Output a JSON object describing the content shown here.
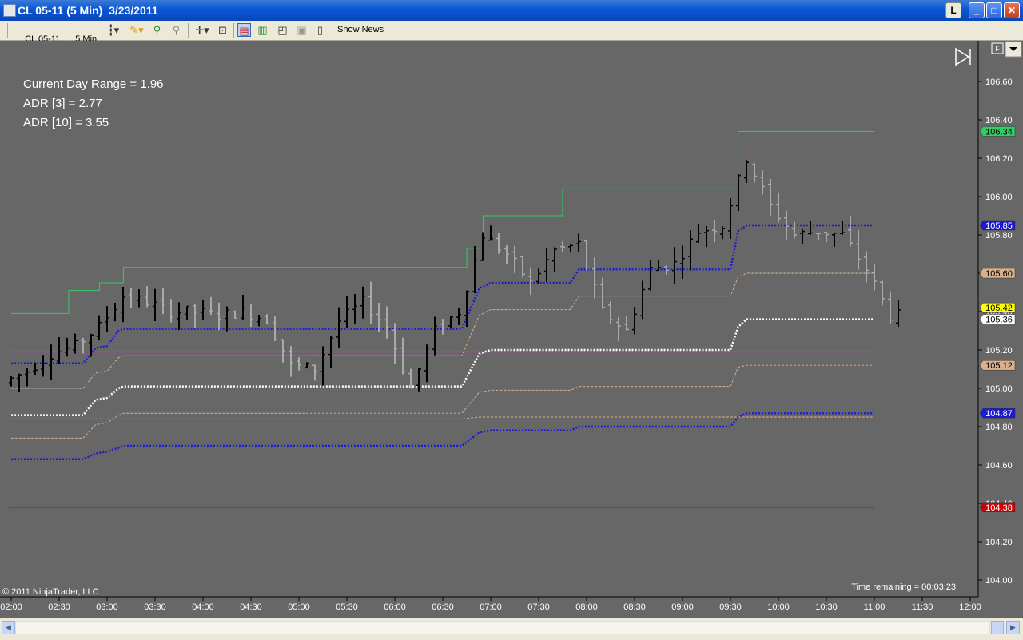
{
  "window": {
    "title": "CL 05-11 (5 Min)  3/23/2011",
    "l_button": "L",
    "minimize": "_",
    "maximize": "□",
    "close": "✕"
  },
  "toolbar": {
    "instrument": "CL 05-11",
    "interval": "5 Min",
    "show_news": "Show News"
  },
  "chart": {
    "stats": [
      "Current Day Range = 1.96",
      "ADR [3] = 2.77",
      "ADR [10] = 3.55"
    ],
    "copyright": "© 2011 NinjaTrader, LLC",
    "time_remaining": "Time remaining = 00:03:23",
    "f_button": "F",
    "colors": {
      "background": "#676767",
      "bar_up": "#000000",
      "bar_down": "#a9a9a9",
      "high_line": "#33cc66",
      "low_line": "#cc0000",
      "magenta_line": "#cc33cc",
      "blue_band": "#1a1ad6",
      "mid_band": "#ffffff",
      "orange_band": "#d8a070"
    }
  },
  "chart_data": {
    "type": "line",
    "title": "CL 05-11 (5 Min) 3/23/2011",
    "xlabel": "",
    "ylabel": "",
    "ylim": [
      103.95,
      106.7
    ],
    "x_ticks": [
      "02:00",
      "02:30",
      "03:00",
      "03:30",
      "04:00",
      "04:30",
      "05:00",
      "05:30",
      "06:00",
      "06:30",
      "07:00",
      "07:30",
      "08:00",
      "08:30",
      "09:00",
      "09:30",
      "10:00",
      "10:30",
      "11:00",
      "11:30",
      "12:00"
    ],
    "y_ticks": [
      "106.60",
      "106.40",
      "106.20",
      "106.00",
      "105.80",
      "105.60",
      "105.40",
      "105.20",
      "105.00",
      "104.80",
      "104.60",
      "104.40",
      "104.20",
      "104.00"
    ],
    "price_markers": [
      {
        "label": "106.34",
        "value": 106.34,
        "color": "#33cc66",
        "text_color": "#000000"
      },
      {
        "label": "105.85",
        "value": 105.85,
        "color": "#1a1ad6",
        "text_color": "#ffffff"
      },
      {
        "label": "105.60",
        "value": 105.6,
        "color": "#d8b08c",
        "text_color": "#000000"
      },
      {
        "label": "105.42",
        "value": 105.42,
        "color": "#ffff00",
        "text_color": "#000000"
      },
      {
        "label": "105.36",
        "value": 105.36,
        "color": "#ffffff",
        "text_color": "#000000"
      },
      {
        "label": "105.12",
        "value": 105.12,
        "color": "#d8b08c",
        "text_color": "#000000"
      },
      {
        "label": "104.87",
        "value": 104.87,
        "color": "#1a1ad6",
        "text_color": "#ffffff"
      },
      {
        "label": "104.38",
        "value": 104.38,
        "color": "#cc0000",
        "text_color": "#ffffff"
      }
    ],
    "horizontal_lines": [
      {
        "name": "day-low",
        "value": 104.38,
        "color": "#cc0000",
        "style": "solid"
      },
      {
        "name": "magenta",
        "value": 105.19,
        "color": "#cc33cc",
        "style": "solid"
      }
    ],
    "step_series": [
      {
        "id": "high",
        "color": "#33cc66",
        "style": "solid",
        "points": [
          [
            2.0,
            105.39
          ],
          [
            2.6,
            105.39
          ],
          [
            2.6,
            105.51
          ],
          [
            2.92,
            105.51
          ],
          [
            2.92,
            105.55
          ],
          [
            3.17,
            105.55
          ],
          [
            3.17,
            105.63
          ],
          [
            6.75,
            105.63
          ],
          [
            6.75,
            105.73
          ],
          [
            6.92,
            105.73
          ],
          [
            6.92,
            105.9
          ],
          [
            7.75,
            105.9
          ],
          [
            7.75,
            106.04
          ],
          [
            9.58,
            106.04
          ],
          [
            9.58,
            106.34
          ],
          [
            11.0,
            106.34
          ]
        ]
      },
      {
        "id": "blue-upper",
        "color": "#1a1ad6",
        "style": "dotted",
        "points": [
          [
            2.0,
            105.13
          ],
          [
            2.75,
            105.13
          ],
          [
            2.88,
            105.21
          ],
          [
            3.0,
            105.22
          ],
          [
            3.12,
            105.3
          ],
          [
            3.17,
            105.31
          ],
          [
            6.7,
            105.31
          ],
          [
            6.88,
            105.52
          ],
          [
            7.0,
            105.55
          ],
          [
            7.83,
            105.55
          ],
          [
            7.92,
            105.62
          ],
          [
            9.5,
            105.62
          ],
          [
            9.58,
            105.82
          ],
          [
            9.67,
            105.85
          ],
          [
            11.0,
            105.85
          ]
        ]
      },
      {
        "id": "orange-upper",
        "color": "#d8b08c",
        "style": "dashed",
        "points": [
          [
            2.0,
            105.0
          ],
          [
            2.75,
            105.0
          ],
          [
            2.88,
            105.08
          ],
          [
            3.0,
            105.09
          ],
          [
            3.12,
            105.16
          ],
          [
            3.17,
            105.17
          ],
          [
            6.7,
            105.17
          ],
          [
            6.88,
            105.38
          ],
          [
            7.0,
            105.41
          ],
          [
            7.83,
            105.41
          ],
          [
            7.92,
            105.48
          ],
          [
            9.5,
            105.48
          ],
          [
            9.58,
            105.58
          ],
          [
            9.67,
            105.6
          ],
          [
            11.0,
            105.6
          ]
        ]
      },
      {
        "id": "white-mid",
        "color": "#ffffff",
        "style": "dotted",
        "points": [
          [
            2.0,
            104.86
          ],
          [
            2.75,
            104.86
          ],
          [
            2.88,
            104.94
          ],
          [
            3.0,
            104.95
          ],
          [
            3.12,
            105.0
          ],
          [
            3.17,
            105.01
          ],
          [
            6.7,
            105.01
          ],
          [
            6.88,
            105.18
          ],
          [
            7.0,
            105.2
          ],
          [
            7.83,
            105.2
          ],
          [
            7.92,
            105.2
          ],
          [
            9.5,
            105.2
          ],
          [
            9.58,
            105.32
          ],
          [
            9.67,
            105.36
          ],
          [
            11.0,
            105.36
          ]
        ]
      },
      {
        "id": "orange-lower",
        "color": "#d8b08c",
        "style": "dashed",
        "points": [
          [
            2.0,
            104.74
          ],
          [
            2.75,
            104.74
          ],
          [
            2.88,
            104.81
          ],
          [
            3.0,
            104.82
          ],
          [
            3.12,
            104.86
          ],
          [
            3.17,
            104.87
          ],
          [
            6.7,
            104.87
          ],
          [
            6.88,
            104.98
          ],
          [
            7.0,
            104.99
          ],
          [
            7.83,
            104.99
          ],
          [
            7.92,
            105.01
          ],
          [
            9.5,
            105.01
          ],
          [
            9.58,
            105.11
          ],
          [
            9.67,
            105.12
          ],
          [
            11.0,
            105.12
          ]
        ]
      },
      {
        "id": "orange-flat",
        "color": "#d8b08c",
        "style": "dashed",
        "points": [
          [
            2.0,
            104.84
          ],
          [
            6.7,
            104.84
          ],
          [
            6.88,
            104.85
          ],
          [
            11.0,
            104.85
          ]
        ]
      },
      {
        "id": "blue-lower",
        "color": "#1a1ad6",
        "style": "dotted",
        "points": [
          [
            2.0,
            104.63
          ],
          [
            2.75,
            104.63
          ],
          [
            2.88,
            104.66
          ],
          [
            3.0,
            104.67
          ],
          [
            3.12,
            104.69
          ],
          [
            3.17,
            104.7
          ],
          [
            6.7,
            104.7
          ],
          [
            6.88,
            104.77
          ],
          [
            7.0,
            104.78
          ],
          [
            7.83,
            104.78
          ],
          [
            7.92,
            104.8
          ],
          [
            9.5,
            104.8
          ],
          [
            9.58,
            104.85
          ],
          [
            9.67,
            104.87
          ],
          [
            11.0,
            104.87
          ]
        ]
      }
    ],
    "ohlc_control_points": [
      [
        2.0,
        105.03
      ],
      [
        2.25,
        105.09
      ],
      [
        2.5,
        105.18
      ],
      [
        2.75,
        105.22
      ],
      [
        3.0,
        105.32
      ],
      [
        3.25,
        105.48
      ],
      [
        3.5,
        105.45
      ],
      [
        3.75,
        105.4
      ],
      [
        4.0,
        105.4
      ],
      [
        4.25,
        105.38
      ],
      [
        4.5,
        105.4
      ],
      [
        4.75,
        105.36
      ],
      [
        5.0,
        105.12
      ],
      [
        5.25,
        105.1
      ],
      [
        5.5,
        105.35
      ],
      [
        5.75,
        105.45
      ],
      [
        6.0,
        105.32
      ],
      [
        6.25,
        105.0
      ],
      [
        6.5,
        105.3
      ],
      [
        6.75,
        105.4
      ],
      [
        7.0,
        105.8
      ],
      [
        7.25,
        105.7
      ],
      [
        7.5,
        105.55
      ],
      [
        7.75,
        105.72
      ],
      [
        8.0,
        105.75
      ],
      [
        8.25,
        105.4
      ],
      [
        8.5,
        105.3
      ],
      [
        8.75,
        105.62
      ],
      [
        9.0,
        105.65
      ],
      [
        9.25,
        105.82
      ],
      [
        9.5,
        105.85
      ],
      [
        9.75,
        106.2
      ],
      [
        10.0,
        105.95
      ],
      [
        10.25,
        105.8
      ],
      [
        10.5,
        105.82
      ],
      [
        10.75,
        105.8
      ],
      [
        11.0,
        105.62
      ],
      [
        11.25,
        105.38
      ]
    ]
  }
}
